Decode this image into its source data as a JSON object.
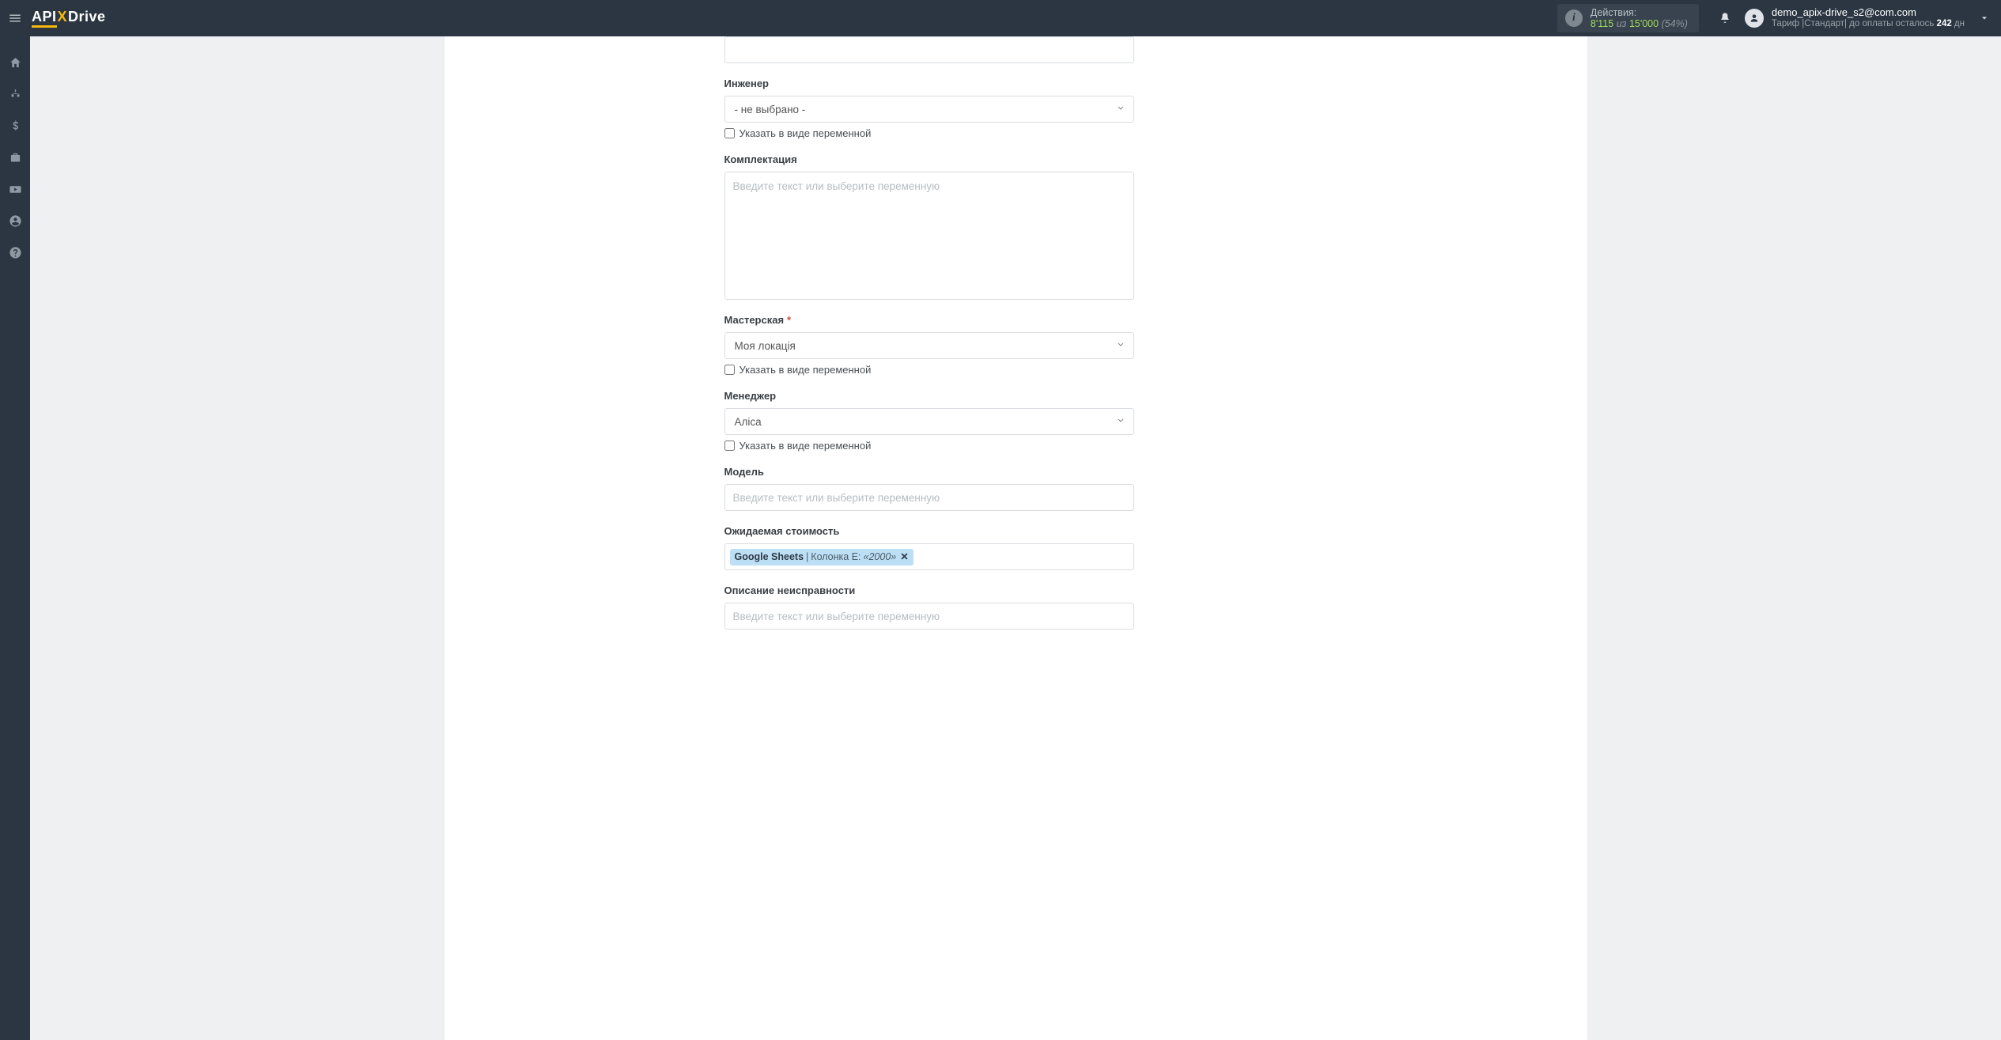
{
  "brand": {
    "api": "API",
    "x": "X",
    "drive": "Drive"
  },
  "header": {
    "actions_label": "Действия:",
    "actions_value": "8'115",
    "actions_of_word": "из",
    "actions_total": "15'000",
    "actions_percent": "(54%)",
    "user_email": "demo_apix-drive_s2@com.com",
    "plan_prefix": "Тариф |Стандарт| до оплаты осталось ",
    "plan_days": "242",
    "plan_suffix": " дн"
  },
  "ui": {
    "checkbox_variable_label": "Указать в виде переменной",
    "placeholder_text": "Введите текст или выберите переменную"
  },
  "form": {
    "field0_value": "",
    "engineer_label": "Инженер",
    "engineer_value": "- не выбрано -",
    "kit_label": "Комплектация",
    "workshop_label": "Мастерская",
    "workshop_value": "Моя локація",
    "manager_label": "Менеджер",
    "manager_value": "Аліса",
    "model_label": "Модель",
    "expected_cost_label": "Ожидаемая стоимость",
    "expected_cost_tag_source": "Google Sheets",
    "expected_cost_tag_sep": " | ",
    "expected_cost_tag_column": "Колонка E: ",
    "expected_cost_tag_value": "«2000»",
    "fault_label": "Описание неисправности"
  }
}
